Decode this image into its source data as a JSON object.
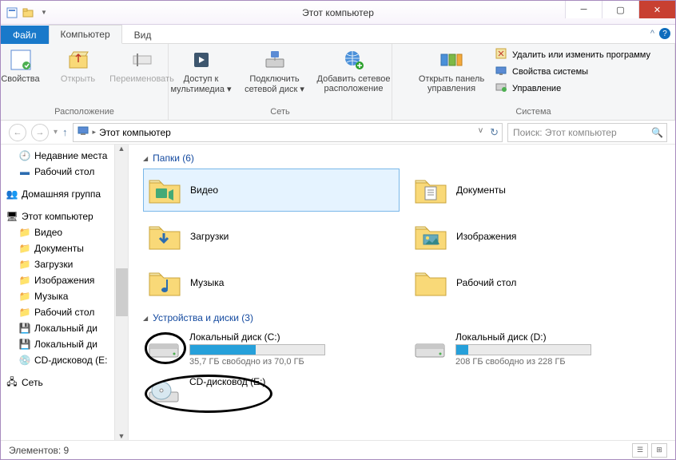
{
  "window": {
    "title": "Этот компьютер"
  },
  "tabs": {
    "file": "Файл",
    "computer": "Компьютер",
    "view": "Вид"
  },
  "ribbon": {
    "location": {
      "label": "Расположение",
      "properties": "Свойства",
      "open": "Открыть",
      "rename": "Переименовать"
    },
    "network": {
      "label": "Сеть",
      "media": "Доступ к мультимедиа",
      "mapdrive": "Подключить сетевой диск",
      "addloc": "Добавить сетевое расположение"
    },
    "system": {
      "label": "Система",
      "cp": "Открыть панель управления",
      "uninstall": "Удалить или изменить программу",
      "props": "Свойства системы",
      "manage": "Управление"
    }
  },
  "breadcrumb": {
    "root": "Этот компьютер"
  },
  "search": {
    "placeholder": "Поиск: Этот компьютер"
  },
  "tree": {
    "recent": "Недавние места",
    "desktop": "Рабочий стол",
    "homegroup": "Домашняя группа",
    "thispc": "Этот компьютер",
    "video": "Видео",
    "documents": "Документы",
    "downloads": "Загрузки",
    "pictures": "Изображения",
    "music": "Музыка",
    "desk2": "Рабочий стол",
    "drivec": "Локальный ди",
    "drived": "Локальный ди",
    "cdrom": "CD-дисковод (E:",
    "network": "Сеть"
  },
  "folders": {
    "header": "Папки (6)",
    "items": [
      {
        "name": "Видео"
      },
      {
        "name": "Документы"
      },
      {
        "name": "Загрузки"
      },
      {
        "name": "Изображения"
      },
      {
        "name": "Музыка"
      },
      {
        "name": "Рабочий стол"
      }
    ]
  },
  "drives": {
    "header": "Устройства и диски (3)",
    "c": {
      "name": "Локальный диск (C:)",
      "free": "35,7 ГБ свободно из 70,0 ГБ",
      "pct": 49
    },
    "d": {
      "name": "Локальный диск (D:)",
      "free": "208 ГБ свободно из 228 ГБ",
      "pct": 9
    },
    "e": {
      "name": "CD-дисковод (E:)"
    }
  },
  "status": {
    "count": "Элементов: 9"
  }
}
